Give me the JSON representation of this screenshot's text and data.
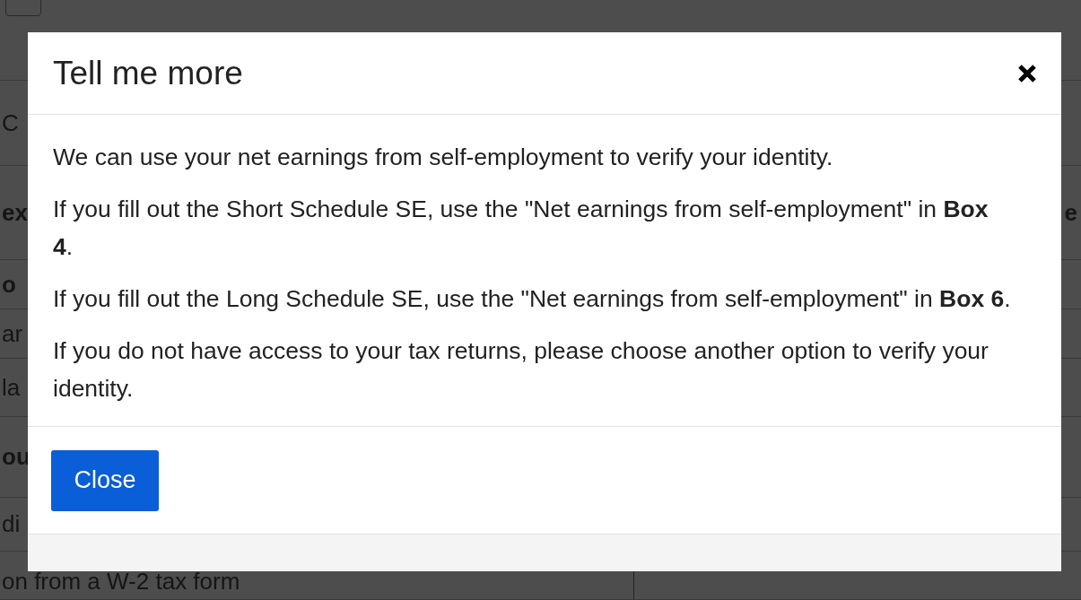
{
  "background": {
    "rows": [
      {
        "left": "C",
        "bold": false
      },
      {
        "left": "ex",
        "right": "e",
        "bold": true
      },
      {
        "left": "o",
        "bold": true
      },
      {
        "left": "ar",
        "bold": false
      },
      {
        "left": "la",
        "bold": false
      },
      {
        "left": "ou",
        "bold": true
      },
      {
        "left": "di",
        "bold": false
      },
      {
        "left": "on from a W-2 tax form",
        "bold": false
      }
    ]
  },
  "modal": {
    "title": "Tell me more",
    "paragraphs": [
      "We can use your net earnings from self-employment to verify your identity.",
      "If you fill out the Short Schedule SE, use the \"Net earnings from self-employment\" in **Box 4**.",
      "If you fill out the Long Schedule SE, use the \"Net earnings from self-employment\" in **Box 6**.",
      "If you do not have access to your tax returns, please choose another option to verify your identity."
    ],
    "buttons": [
      "Close"
    ]
  }
}
